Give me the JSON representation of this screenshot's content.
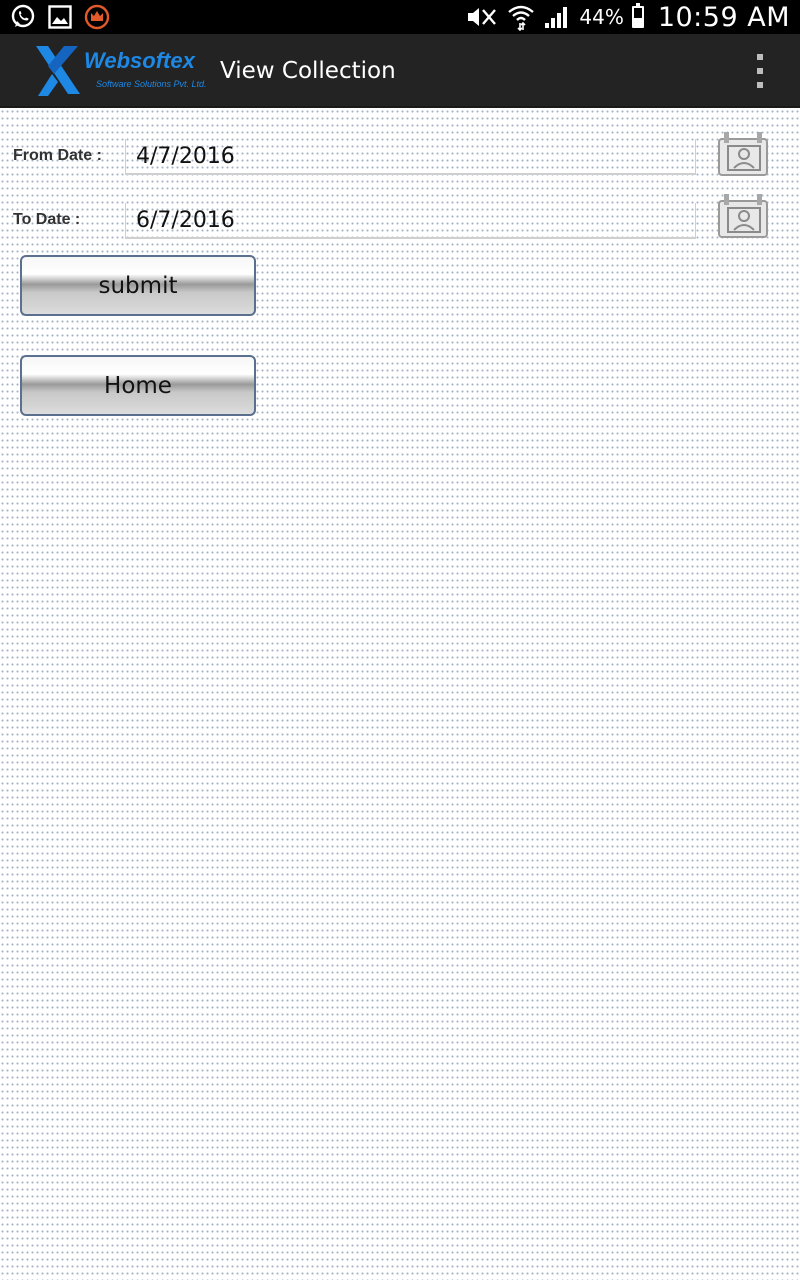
{
  "status_bar": {
    "battery_percent": "44%",
    "battery_level": 0.44,
    "time": "10:59 AM",
    "left_icons": [
      "whatsapp-icon",
      "gallery-icon",
      "crown-app-icon"
    ],
    "right_icons": [
      "mute-icon",
      "wifi-icon",
      "signal-icon",
      "battery-icon"
    ]
  },
  "action_bar": {
    "logo_name": "Websoftex",
    "logo_tagline": "Software Solutions Pvt. Ltd.",
    "title": "View Collection",
    "menu_icon": "overflow-menu-icon"
  },
  "form": {
    "from_label": "From Date :",
    "from_value": "4/7/2016",
    "to_label": "To Date :",
    "to_value": "6/7/2016",
    "calendar_icon": "calendar-icon"
  },
  "buttons": {
    "submit": "submit",
    "home": "Home"
  },
  "colors": {
    "action_bar_bg": "#232323",
    "logo_blue": "#1e88e5",
    "button_border": "#5b6f8f"
  }
}
